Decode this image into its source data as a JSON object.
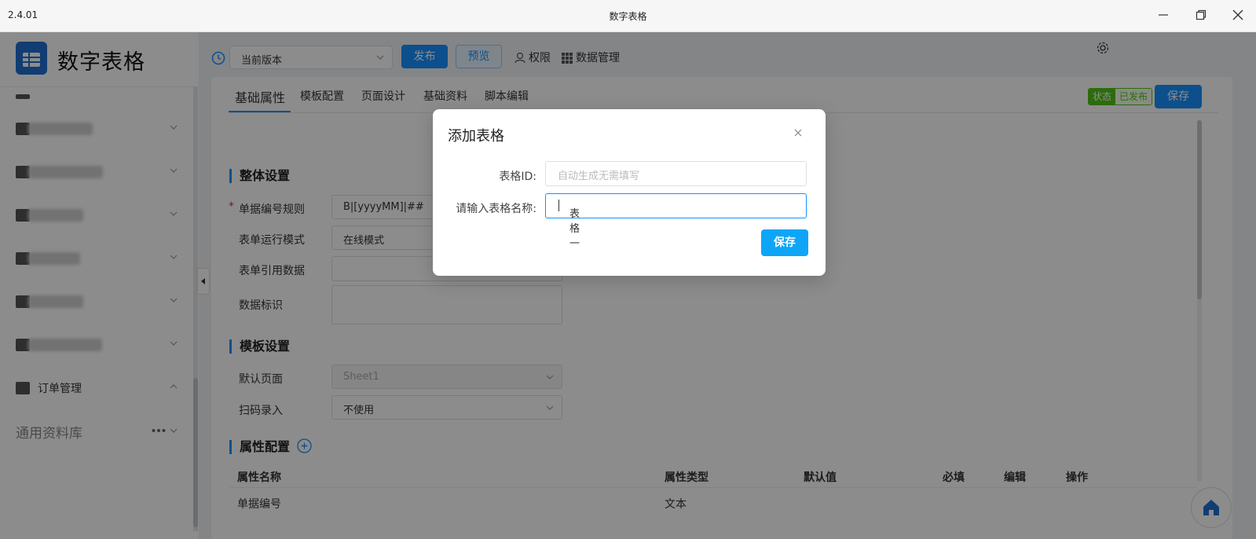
{
  "window": {
    "version": "2.4.01",
    "title": "数字表格"
  },
  "sidebar": {
    "app_name": "数字表格",
    "items": [
      {
        "label": "订单管理"
      }
    ],
    "library": "通用资料库"
  },
  "toolbar": {
    "version_select": "当前版本",
    "publish": "发布",
    "preview": "预览",
    "permissions": "权限",
    "data_management": "数据管理"
  },
  "tabs": [
    "基础属性",
    "模板配置",
    "页面设计",
    "基础资料",
    "脚本编辑"
  ],
  "status": {
    "key": "状态",
    "value": "已发布"
  },
  "save_button": "保存",
  "sections": {
    "overall": "整体设置",
    "template": "模板设置",
    "attributes": "属性配置"
  },
  "form": {
    "number_rule": {
      "label": "单据编号规则",
      "value": "B|[yyyyMM]|##",
      "required": "*"
    },
    "run_mode": {
      "label": "表单运行模式",
      "value": "在线模式"
    },
    "ref_data": {
      "label": "表单引用数据",
      "value": ""
    },
    "data_tag": {
      "label": "数据标识",
      "value": ""
    },
    "default_page": {
      "label": "默认页面",
      "value": "Sheet1"
    },
    "scan_input": {
      "label": "扫码录入",
      "value": "不使用"
    }
  },
  "table": {
    "headers": [
      "属性名称",
      "属性类型",
      "默认值",
      "必填",
      "编辑",
      "操作"
    ],
    "rows": [
      [
        "单据编号",
        "文本"
      ]
    ]
  },
  "modal": {
    "title": "添加表格",
    "id_label": "表格ID:",
    "id_placeholder": "自动生成无需填写",
    "name_label": "请输入表格名称:",
    "name_value": "表格一",
    "save": "保存"
  },
  "colors": {
    "primary": "#1890ff",
    "success": "#52c41a",
    "modal_save": "#0ea5f7"
  }
}
